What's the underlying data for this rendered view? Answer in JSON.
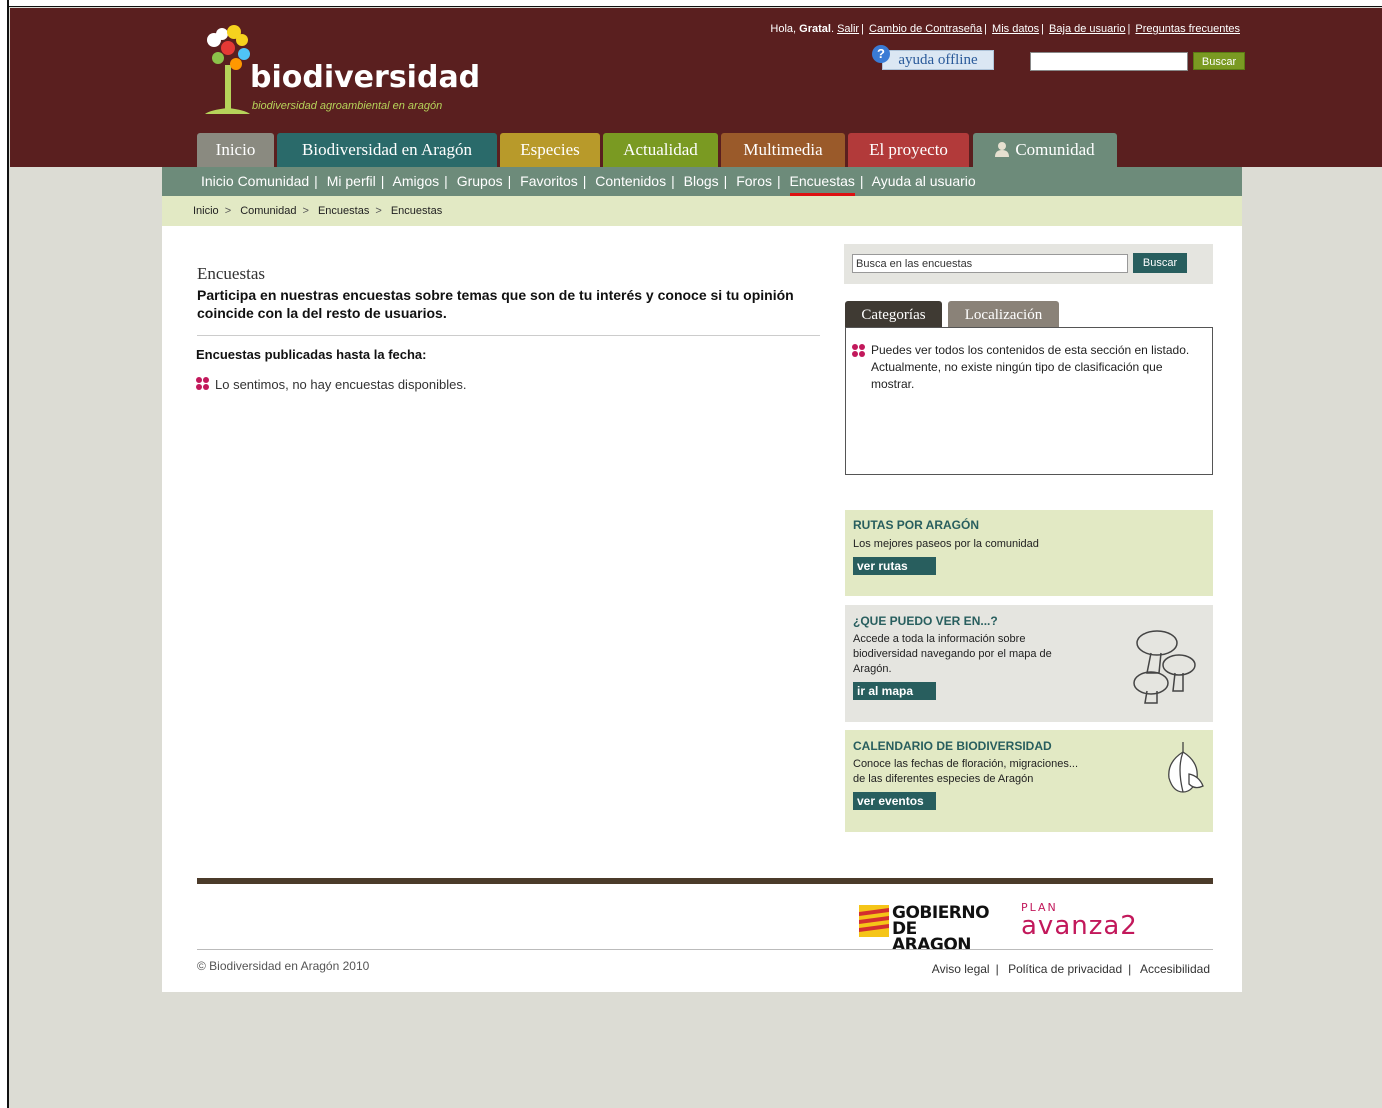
{
  "header": {
    "logo_word": "biodiversidad",
    "logo_tagline": "biodiversidad agroambiental en aragón",
    "greeting_prefix": "Hola,",
    "user_name": "Gratal",
    "links": [
      "Salir",
      "Cambio de Contraseña",
      "Mis datos",
      "Baja de usuario",
      "Preguntas frecuentes"
    ],
    "help_label": "ayuda offline",
    "search_button": "Buscar"
  },
  "tabs": [
    {
      "label": "Inicio",
      "color": "#8a8a80"
    },
    {
      "label": "Biodiversidad en Aragón",
      "color": "#2a6a6a"
    },
    {
      "label": "Especies",
      "color": "#b89a2a"
    },
    {
      "label": "Actualidad",
      "color": "#7a9a22"
    },
    {
      "label": "Multimedia",
      "color": "#9a5a2a"
    },
    {
      "label": "El proyecto",
      "color": "#b23a3a"
    },
    {
      "label": "Comunidad",
      "color": "#6d8b7a"
    }
  ],
  "subnav": [
    "Inicio Comunidad",
    "Mi perfil",
    "Amigos",
    "Grupos",
    "Favoritos",
    "Contenidos",
    "Blogs",
    "Foros",
    "Encuestas",
    "Ayuda al usuario"
  ],
  "breadcrumb": [
    "Inicio",
    "Comunidad",
    "Encuestas",
    "Encuestas"
  ],
  "main": {
    "title": "Encuestas",
    "intro": "Participa en nuestras encuestas sobre temas que son de tu interés y conoce si tu opinión coincide con la del resto de usuarios.",
    "published_label": "Encuestas publicadas hasta la fecha:",
    "no_results": "Lo sentimos, no hay encuestas disponibles."
  },
  "sidebar": {
    "search_placeholder": "Busca en las encuestas",
    "search_button": "Buscar",
    "cat_tabs": [
      "Categorías",
      "Localización"
    ],
    "cat_text_1": "Puedes ver todos los contenidos de esta sección en listado.",
    "cat_text_2": "Actualmente, no existe ningún tipo de clasificación que mostrar.",
    "promos": [
      {
        "title": "RUTAS POR ARAGÓN",
        "desc": "Los mejores paseos por la comunidad",
        "button": "ver rutas"
      },
      {
        "title": "¿QUE PUEDO VER EN...?",
        "desc": "Accede a toda la información sobre biodiversidad navegando por el mapa de Aragón.",
        "button": "ir al mapa"
      },
      {
        "title": "CALENDARIO DE BIODIVERSIDAD",
        "desc_1": "Conoce las fechas de floración, migraciones...",
        "desc_2": "de las diferentes especies de Aragón",
        "button": "ver eventos"
      }
    ]
  },
  "footer": {
    "gov_line1": "GOBIERNO",
    "gov_line2": "DE ARAGON",
    "plan_small": "PLAN",
    "plan_big": "avanza2",
    "copyright": "© Biodiversidad en Aragón 2010",
    "links": [
      "Aviso legal",
      "Política de privacidad",
      "Accesibilidad"
    ]
  }
}
